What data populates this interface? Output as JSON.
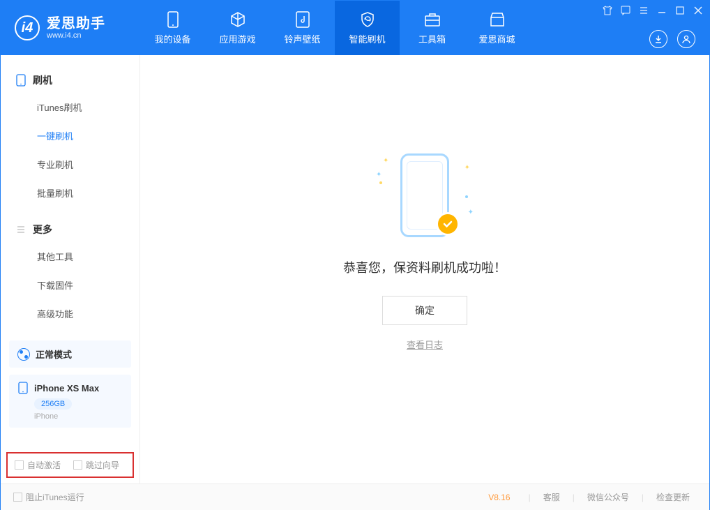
{
  "app": {
    "title": "爱思助手",
    "url": "www.i4.cn"
  },
  "tabs": [
    {
      "label": "我的设备"
    },
    {
      "label": "应用游戏"
    },
    {
      "label": "铃声壁纸"
    },
    {
      "label": "智能刷机"
    },
    {
      "label": "工具箱"
    },
    {
      "label": "爱思商城"
    }
  ],
  "sidebar": {
    "section1": {
      "title": "刷机",
      "items": [
        "iTunes刷机",
        "一键刷机",
        "专业刷机",
        "批量刷机"
      ]
    },
    "section2": {
      "title": "更多",
      "items": [
        "其他工具",
        "下载固件",
        "高级功能"
      ]
    }
  },
  "device": {
    "mode": "正常模式",
    "name": "iPhone XS Max",
    "storage": "256GB",
    "type": "iPhone"
  },
  "checkboxes": {
    "auto_activate": "自动激活",
    "skip_guide": "跳过向导"
  },
  "main": {
    "success_text": "恭喜您，保资料刷机成功啦！",
    "ok_button": "确定",
    "log_link": "查看日志"
  },
  "footer": {
    "block_itunes": "阻止iTunes运行",
    "version": "V8.16",
    "links": [
      "客服",
      "微信公众号",
      "检查更新"
    ]
  }
}
